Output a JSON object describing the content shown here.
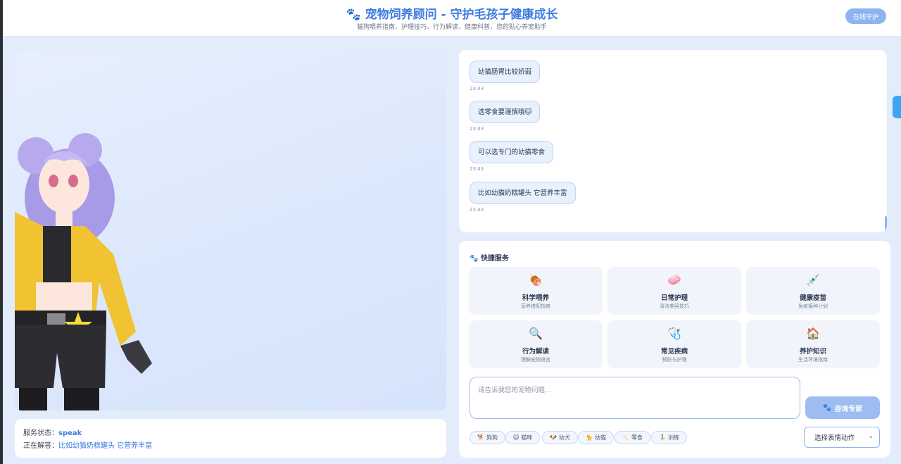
{
  "header": {
    "title": "宠物饲养顾问 - 守护毛孩子健康成长",
    "subtitle": "猫狗喂养指南、护理技巧、行为解读、健康科普，您的贴心养宠助手",
    "online_button": "在线守护"
  },
  "status": {
    "service_label": "服务状态：",
    "service_value": "speak",
    "answering_label": "正在解答：",
    "answering_value": "比如幼猫奶糕罐头 它营养丰富"
  },
  "chat": {
    "messages": [
      {
        "text": "幼猫肠胃比较娇弱",
        "time": "23:43"
      },
      {
        "text": "选零食要谨慎哦🐱",
        "time": "23:43"
      },
      {
        "text": "可以选专门的幼猫零食",
        "time": "23:43"
      },
      {
        "text": "比如幼猫奶糕罐头 它营养丰富",
        "time": "23:43"
      }
    ]
  },
  "services": {
    "title": "快捷服务",
    "items": [
      {
        "icon": "🍖",
        "icon_name": "meat-icon",
        "name": "科学喂养",
        "desc": "营养搭配指南"
      },
      {
        "icon": "🧼",
        "icon_name": "soap-icon",
        "name": "日常护理",
        "desc": "清洁美容技巧"
      },
      {
        "icon": "💉",
        "icon_name": "syringe-icon",
        "name": "健康疫苗",
        "desc": "免疫接种计划"
      },
      {
        "icon": "🔍",
        "icon_name": "magnifier-icon",
        "name": "行为解读",
        "desc": "理解宠物语言"
      },
      {
        "icon": "🩺",
        "icon_name": "stethoscope-icon",
        "name": "常见疾病",
        "desc": "预防与护理"
      },
      {
        "icon": "🏠",
        "icon_name": "house-icon",
        "name": "养护知识",
        "desc": "生活环境指南"
      }
    ]
  },
  "input": {
    "placeholder": "请告诉我您的宠物问题...",
    "consult_button": "咨询专家",
    "expression_select": "选择表情动作"
  },
  "chips": [
    {
      "icon": "🐕",
      "label": "狗狗"
    },
    {
      "icon": "🐱",
      "label": "猫咪"
    },
    {
      "icon": "🐶",
      "label": "幼犬"
    },
    {
      "icon": "🐈",
      "label": "幼猫"
    },
    {
      "icon": "🦴",
      "label": "零食"
    },
    {
      "icon": "🏃",
      "label": "训练"
    }
  ],
  "colors": {
    "accent": "#3f7be0",
    "background": "#e3ecfb",
    "bubble": "#e9f1fd"
  }
}
